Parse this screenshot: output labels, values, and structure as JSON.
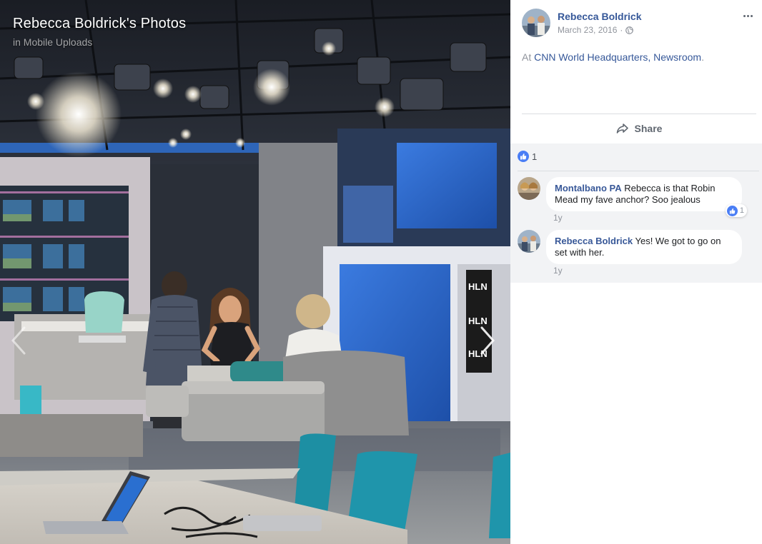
{
  "photo": {
    "title": "Rebecca Boldrick's Photos",
    "album": "in Mobile Uploads",
    "wall_logos": [
      "HLN",
      "HLN",
      "HLN"
    ],
    "prev_icon": "chevron-left-icon",
    "next_icon": "chevron-right-icon"
  },
  "post": {
    "author": "Rebecca Boldrick",
    "date": "March 23, 2016",
    "separator": "·",
    "privacy_icon": "globe-icon",
    "text_prefix": "At ",
    "place": "CNN World Headquarters, Newsroom",
    "text_suffix": ".",
    "more_icon": "ellipsis-icon"
  },
  "actions": {
    "share_label": "Share",
    "share_icon": "share-icon"
  },
  "reactions": {
    "count": "1",
    "icon": "like-icon"
  },
  "comments": [
    {
      "author": "Montalbano PA",
      "text": "Rebecca is that Robin Mead my fave anchor? Soo jealous",
      "time": "1y",
      "reaction_count": "1"
    },
    {
      "author": "Rebecca Boldrick",
      "text": "Yes! We got to go on set with her.",
      "time": "1y",
      "reaction_count": ""
    }
  ],
  "colors": {
    "link": "#365899",
    "like_blue": "#4a7ef5",
    "comments_bg": "#f2f3f5",
    "studio_blue": "#2b6fd6"
  }
}
